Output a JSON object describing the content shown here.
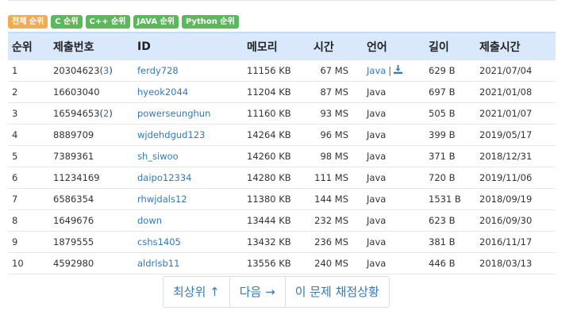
{
  "filters": [
    {
      "label": "전체 순위",
      "style": "active"
    },
    {
      "label": "C 순위",
      "style": "green"
    },
    {
      "label": "C++ 순위",
      "style": "green"
    },
    {
      "label": "JAVA 순위",
      "style": "green"
    },
    {
      "label": "Python 순위",
      "style": "green"
    }
  ],
  "columns": [
    "순위",
    "제출번호",
    "ID",
    "메모리",
    "시간",
    "언어",
    "길이",
    "제출시간"
  ],
  "rows": [
    {
      "rank": "1",
      "submission": "20304623",
      "count": "3",
      "id": "ferdy728",
      "memory": "11156 KB",
      "time": "67 MS",
      "lang": "Java",
      "lang_link": true,
      "download": true,
      "length": "629 B",
      "date": "2021/07/04"
    },
    {
      "rank": "2",
      "submission": "16603040",
      "count": "",
      "id": "hyeok2044",
      "memory": "11204 KB",
      "time": "87 MS",
      "lang": "Java",
      "lang_link": false,
      "download": false,
      "length": "697 B",
      "date": "2021/01/08"
    },
    {
      "rank": "3",
      "submission": "16594653",
      "count": "2",
      "id": "powerseunghun",
      "memory": "11160 KB",
      "time": "93 MS",
      "lang": "Java",
      "lang_link": false,
      "download": false,
      "length": "505 B",
      "date": "2021/01/07"
    },
    {
      "rank": "4",
      "submission": "8889709",
      "count": "",
      "id": "wjdehdgud123",
      "memory": "14264 KB",
      "time": "96 MS",
      "lang": "Java",
      "lang_link": false,
      "download": false,
      "length": "399 B",
      "date": "2019/05/17"
    },
    {
      "rank": "5",
      "submission": "7389361",
      "count": "",
      "id": "sh_siwoo",
      "memory": "14260 KB",
      "time": "98 MS",
      "lang": "Java",
      "lang_link": false,
      "download": false,
      "length": "371 B",
      "date": "2018/12/31"
    },
    {
      "rank": "6",
      "submission": "11234169",
      "count": "",
      "id": "daipo12334",
      "memory": "14280 KB",
      "time": "111 MS",
      "lang": "Java",
      "lang_link": false,
      "download": false,
      "length": "720 B",
      "date": "2019/11/06"
    },
    {
      "rank": "7",
      "submission": "6586354",
      "count": "",
      "id": "rhwjdals12",
      "memory": "11380 KB",
      "time": "144 MS",
      "lang": "Java",
      "lang_link": false,
      "download": false,
      "length": "1531 B",
      "date": "2018/09/19"
    },
    {
      "rank": "8",
      "submission": "1649676",
      "count": "",
      "id": "down",
      "memory": "13444 KB",
      "time": "232 MS",
      "lang": "Java",
      "lang_link": false,
      "download": false,
      "length": "623 B",
      "date": "2016/09/30"
    },
    {
      "rank": "9",
      "submission": "1879555",
      "count": "",
      "id": "cshs1405",
      "memory": "13432 KB",
      "time": "236 MS",
      "lang": "Java",
      "lang_link": false,
      "download": false,
      "length": "381 B",
      "date": "2016/11/17"
    },
    {
      "rank": "10",
      "submission": "4592980",
      "count": "",
      "id": "aldrlsb11",
      "memory": "13556 KB",
      "time": "240 MS",
      "lang": "Java",
      "lang_link": false,
      "download": false,
      "length": "446 B",
      "date": "2018/03/13"
    }
  ],
  "download_icon": "download-icon",
  "pager": {
    "top_label": "최상위 ↑",
    "next_label": "다음 →",
    "status_label": "이 문제 채점상황"
  },
  "colors": {
    "link": "#337ab7",
    "header_bg": "#d9e9fb",
    "active_badge": "#f0ad4e",
    "green_badge": "#5cb85c"
  }
}
